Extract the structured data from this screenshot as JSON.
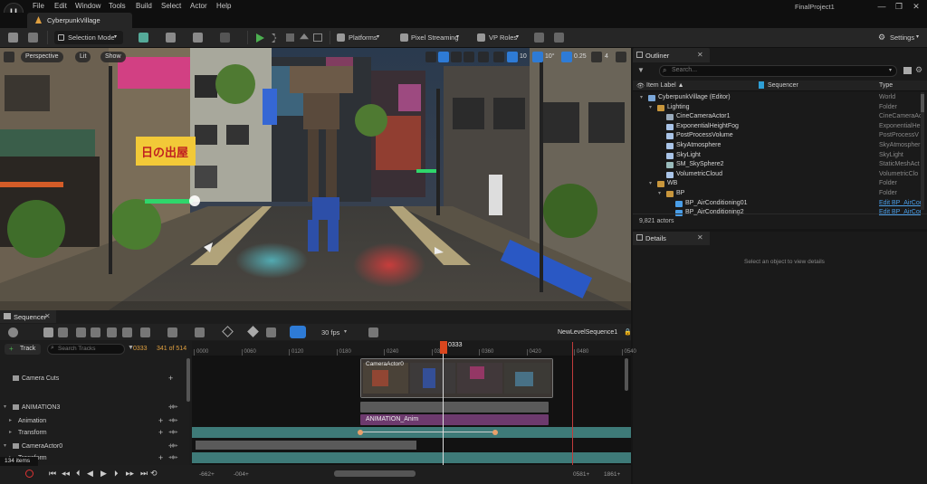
{
  "menubar": {
    "logo": "U",
    "items": [
      "File",
      "Edit",
      "Window",
      "Tools",
      "Build",
      "Select",
      "Actor",
      "Help"
    ],
    "project": "FinalProject1",
    "window_buttons": [
      "—",
      "❐",
      "✕"
    ]
  },
  "level_tab": {
    "label": "CyberpunkVillage"
  },
  "toolbar": {
    "selection_mode": "Selection Mode",
    "platforms": "Platforms",
    "pixel_streaming": "Pixel Streaming",
    "vp_roles": "VP Roles",
    "settings": "Settings"
  },
  "viewport": {
    "perspective": "Perspective",
    "lit": "Lit",
    "show": "Show",
    "grid_snap": "10",
    "rot_snap": "10°",
    "scale_snap": "0.25",
    "cam_speed": "4",
    "signs": {
      "shop_sign": "日の出屋"
    }
  },
  "outliner": {
    "tab_label": "Outliner",
    "search_placeholder": "Search...",
    "columns": [
      "Item Label ▲",
      "Sequencer",
      "Type"
    ],
    "rows": [
      {
        "label": "CyberpunkVillage (Editor)",
        "type": "World",
        "indent": 0,
        "icon": "world"
      },
      {
        "label": "Lighting",
        "type": "Folder",
        "indent": 1,
        "icon": "folder"
      },
      {
        "label": "CineCameraActor1",
        "type": "CineCameraAct",
        "indent": 2,
        "icon": "camera"
      },
      {
        "label": "ExponentialHeightFog",
        "type": "ExponentialHe",
        "indent": 2,
        "icon": "actor"
      },
      {
        "label": "PostProcessVolume",
        "type": "PostProcessV",
        "indent": 2,
        "icon": "actor"
      },
      {
        "label": "SkyAtmosphere",
        "type": "SkyAtmospher",
        "indent": 2,
        "icon": "actor"
      },
      {
        "label": "SkyLight",
        "type": "SkyLight",
        "indent": 2,
        "icon": "actor"
      },
      {
        "label": "SM_SkySphere2",
        "type": "StaticMeshAct",
        "indent": 2,
        "icon": "mesh"
      },
      {
        "label": "VolumetricCloud",
        "type": "VolumetricClo",
        "indent": 2,
        "icon": "actor"
      },
      {
        "label": "WB",
        "type": "Folder",
        "indent": 1,
        "icon": "folder"
      },
      {
        "label": "BP",
        "type": "Folder",
        "indent": 2,
        "icon": "folder"
      },
      {
        "label": "BP_AirConditioning01",
        "type": "Edit BP_AirCor",
        "indent": 3,
        "icon": "bp"
      },
      {
        "label": "BP_AirConditioning2",
        "type": "Edit BP_AirCor",
        "indent": 3,
        "icon": "bp"
      }
    ],
    "actor_count": "9,821 actors"
  },
  "details": {
    "tab_label": "Details",
    "empty_text": "Select an object to view details"
  },
  "sequencer": {
    "tab_label": "Sequencer",
    "sequence_name": "NewLevelSequence1",
    "fps": "30 fps",
    "add_track": "Track",
    "search_placeholder": "Search Tracks",
    "current_frame": "0333",
    "frame_of": "341 of 514",
    "playhead_label": "0333",
    "ruler_ticks": [
      "0000",
      "0060",
      "0120",
      "0180",
      "0240",
      "0300",
      "0360",
      "0420",
      "0480",
      "0540"
    ],
    "tracks": [
      {
        "label": "Camera Cuts",
        "kind": "camera"
      },
      {
        "label": "ANIMATION3",
        "kind": "actor"
      },
      {
        "label": "Animation",
        "kind": "sub"
      },
      {
        "label": "Transform",
        "kind": "sub"
      },
      {
        "label": "CameraActor0",
        "kind": "actor"
      },
      {
        "label": "Transform",
        "kind": "sub"
      }
    ],
    "clips": {
      "camera": "CameraActor0",
      "anim": "ANIMATION_Anim"
    },
    "items_count": "134 items",
    "range_start": "-662+",
    "range_start2": "-004+",
    "range_end": "0581+",
    "range_end2": "1861+"
  },
  "colors": {
    "accent_blue": "#2e7bd6",
    "playhead": "#d9461e",
    "teal_track": "#3e7a78",
    "anim_clip": "#6d3a6e",
    "folder": "#c8963c",
    "link": "#4a9ee8"
  }
}
